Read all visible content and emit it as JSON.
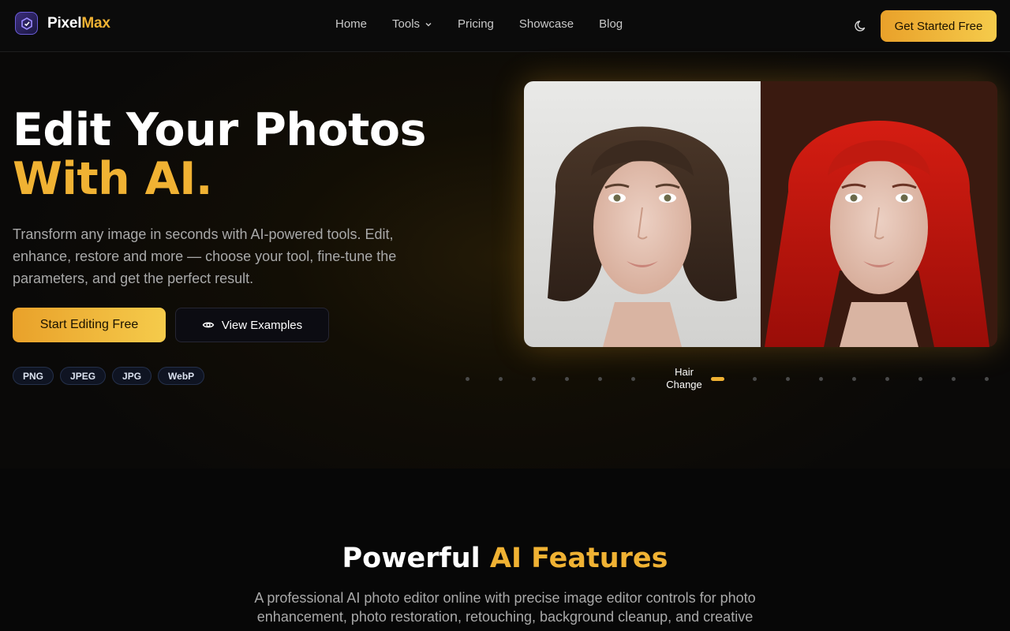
{
  "brand": {
    "name_part1": "Pixel",
    "name_part2": "Max",
    "accent_color": "#f0b233"
  },
  "nav": {
    "home": "Home",
    "tools": "Tools",
    "pricing": "Pricing",
    "showcase": "Showcase",
    "blog": "Blog"
  },
  "header": {
    "cta_label": "Get Started Free",
    "theme_icon": "moon-icon"
  },
  "hero": {
    "title_line1": "Edit Your Photos",
    "title_line2": "With AI.",
    "subtitle": "Transform any image in seconds with AI-powered tools. Edit, enhance, restore and more — choose your tool, fine-tune the parameters, and get the perfect result.",
    "primary_button": "Start Editing Free",
    "secondary_button": "View Examples",
    "formats": [
      "PNG",
      "JPEG",
      "JPG",
      "WebP"
    ]
  },
  "carousel": {
    "active_label_line1": "Hair",
    "active_label_line2": "Change",
    "dot_count": 16,
    "active_index": 6
  },
  "features": {
    "title_part1": "Powerful ",
    "title_part2": "AI Features",
    "subtitle": "A professional AI photo editor online with precise image editor controls for photo enhancement, photo restoration, retouching, background cleanup, and creative"
  }
}
